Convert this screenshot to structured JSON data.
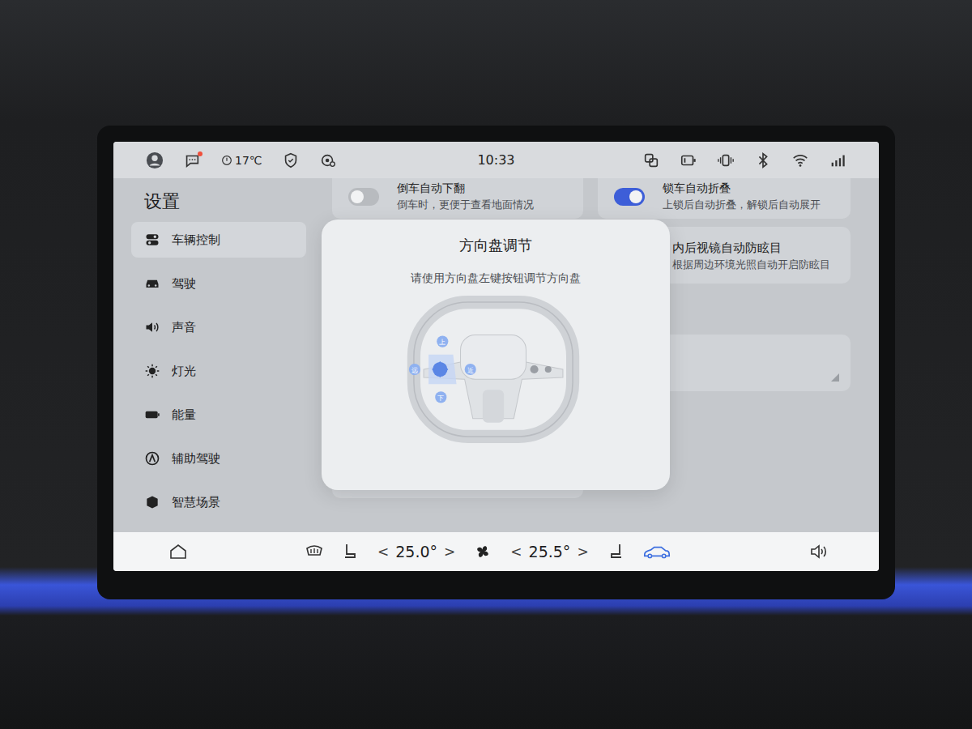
{
  "status_bar": {
    "temperature": "17℃",
    "time": "10:33",
    "message_badge": true
  },
  "sidebar": {
    "title": "设置",
    "items": [
      {
        "label": "车辆控制",
        "selected": true
      },
      {
        "label": "驾驶",
        "selected": false
      },
      {
        "label": "声音",
        "selected": false
      },
      {
        "label": "灯光",
        "selected": false
      },
      {
        "label": "能量",
        "selected": false
      },
      {
        "label": "辅助驾驶",
        "selected": false
      },
      {
        "label": "智慧场景",
        "selected": false
      }
    ]
  },
  "toggles": [
    {
      "title": "倒车自动下翻",
      "description": "倒车时，更便于查看地面情况",
      "on": false
    },
    {
      "title": "锁车自动折叠",
      "description": "上锁后自动折叠，解锁后自动展开",
      "on": true
    }
  ],
  "notices": [
    {
      "title": "内后视镜自动防眩目",
      "description": "根据周边环境光照自动开启防眩目"
    }
  ],
  "dialog": {
    "title": "方向盘调节",
    "message": "请使用方向盘左键按钮调节方向盘",
    "labels": {
      "up": "上",
      "down": "下",
      "far": "远",
      "near": "近"
    }
  },
  "dock": {
    "zones": [
      {
        "dec": "<",
        "value": "25.0°",
        "inc": ">"
      },
      {
        "dec": "<",
        "value": "25.5°",
        "inc": ">"
      }
    ],
    "vehicle_selected": true
  }
}
